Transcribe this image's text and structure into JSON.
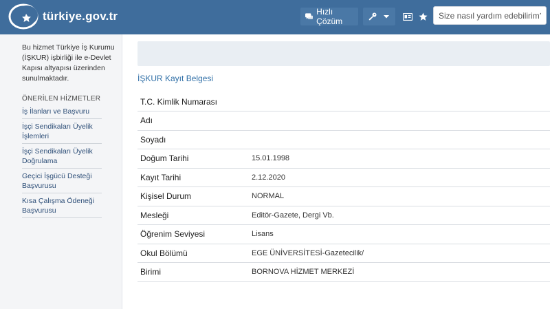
{
  "header": {
    "logo_text": "türkiye.gov.tr",
    "quick_solution_label": "Hızlı Çözüm",
    "search_placeholder": "Size nasıl yardım edebilirim?"
  },
  "icons": {
    "logo": "crescent-logo-icon",
    "quick_solution": "chat-icon",
    "login": "key-icon",
    "dropdown": "caret-down-icon",
    "id_card": "id-card-icon",
    "favorite": "star-icon"
  },
  "sidebar": {
    "note": "Bu hizmet Türkiye İş Kurumu (İŞKUR) işbirliği ile e-Devlet Kapısı altyapısı üzerinden sunulmaktadır.",
    "heading": "ÖNERİLEN HİZMETLER",
    "items": [
      {
        "label": "İş İlanları ve Başvuru"
      },
      {
        "label": "İşçi Sendikaları Üyelik İşlemleri"
      },
      {
        "label": "İşçi Sendikaları Üyelik Doğrulama"
      },
      {
        "label": "Geçici İşgücü Desteği Başvurusu"
      },
      {
        "label": "Kısa Çalışma Ödeneği Başvurusu"
      }
    ]
  },
  "main": {
    "document_link": "İŞKUR Kayıt Belgesi",
    "rows": [
      {
        "label": "T.C. Kimlik Numarası",
        "value": ""
      },
      {
        "label": "Adı",
        "value": ""
      },
      {
        "label": "Soyadı",
        "value": ""
      },
      {
        "label": "Doğum Tarihi",
        "value": "15.01.1998"
      },
      {
        "label": "Kayıt Tarihi",
        "value": "2.12.2020"
      },
      {
        "label": "Kişisel Durum",
        "value": "NORMAL"
      },
      {
        "label": "Mesleği",
        "value": "Editör-Gazete, Dergi Vb."
      },
      {
        "label": "Öğrenim Seviyesi",
        "value": "Lisans"
      },
      {
        "label": "Okul Bölümü",
        "value": "EGE ÜNİVERSİTESİ-Gazetecilik/"
      },
      {
        "label": "Birimi",
        "value": "BORNOVA HİZMET MERKEZİ"
      }
    ]
  },
  "colors": {
    "header_bg": "#3f6d9c",
    "sidebar_bg": "#f4f5f7",
    "link": "#2e6ea6"
  }
}
